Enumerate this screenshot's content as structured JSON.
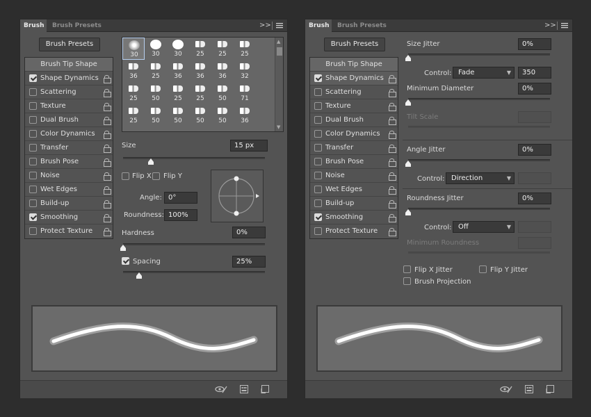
{
  "colors": {
    "bg": "#2d2d2d",
    "panel": "#535353",
    "field": "#3a3a3a",
    "preview": "#6b6b6b"
  },
  "panel1": {
    "tabs": [
      "Brush",
      "Brush Presets"
    ],
    "menu_glyph": ">>",
    "brush_presets_label": "Brush Presets",
    "list": [
      {
        "label": "Brush Tip Shape",
        "header": true
      },
      {
        "label": "Shape Dynamics",
        "checked": true
      },
      {
        "label": "Scattering",
        "checked": false
      },
      {
        "label": "Texture",
        "checked": false
      },
      {
        "label": "Dual Brush",
        "checked": false
      },
      {
        "label": "Color Dynamics",
        "checked": false
      },
      {
        "label": "Transfer",
        "checked": false
      },
      {
        "label": "Brush Pose",
        "checked": false
      },
      {
        "label": "Noise",
        "checked": false
      },
      {
        "label": "Wet Edges",
        "checked": false
      },
      {
        "label": "Build-up",
        "checked": false
      },
      {
        "label": "Smoothing",
        "checked": true
      },
      {
        "label": "Protect Texture",
        "checked": false
      }
    ],
    "tips": [
      "30",
      "30",
      "30",
      "25",
      "25",
      "25",
      "36",
      "25",
      "36",
      "36",
      "36",
      "32",
      "25",
      "50",
      "25",
      "25",
      "50",
      "71",
      "25",
      "50",
      "50",
      "50",
      "50",
      "36"
    ],
    "size_label": "Size",
    "size_value": "15 px",
    "flip_x_label": "Flip X",
    "flip_y_label": "Flip Y",
    "angle_label": "Angle:",
    "angle_value": "0°",
    "roundness_label": "Roundness:",
    "roundness_value": "100%",
    "hardness_label": "Hardness",
    "hardness_value": "0%",
    "spacing_label": "Spacing",
    "spacing_value": "25%"
  },
  "panel2": {
    "tabs": [
      "Brush",
      "Brush Presets"
    ],
    "menu_glyph": ">>",
    "brush_presets_label": "Brush Presets",
    "list": [
      {
        "label": "Brush Tip Shape",
        "header": true
      },
      {
        "label": "Shape Dynamics",
        "checked": true
      },
      {
        "label": "Scattering",
        "checked": false
      },
      {
        "label": "Texture",
        "checked": false
      },
      {
        "label": "Dual Brush",
        "checked": false
      },
      {
        "label": "Color Dynamics",
        "checked": false
      },
      {
        "label": "Transfer",
        "checked": false
      },
      {
        "label": "Brush Pose",
        "checked": false
      },
      {
        "label": "Noise",
        "checked": false
      },
      {
        "label": "Wet Edges",
        "checked": false
      },
      {
        "label": "Build-up",
        "checked": false
      },
      {
        "label": "Smoothing",
        "checked": true
      },
      {
        "label": "Protect Texture",
        "checked": false
      }
    ],
    "size_jitter_label": "Size Jitter",
    "size_jitter_value": "0%",
    "control_label": "Control:",
    "control_fade": "Fade",
    "fade_steps": "350",
    "min_diameter_label": "Minimum Diameter",
    "min_diameter_value": "0%",
    "tilt_scale_label": "Tilt Scale",
    "angle_jitter_label": "Angle Jitter",
    "angle_jitter_value": "0%",
    "control_direction": "Direction",
    "roundness_jitter_label": "Roundness Jitter",
    "roundness_jitter_value": "0%",
    "control_off": "Off",
    "min_roundness_label": "Minimum Roundness",
    "flip_x_jitter_label": "Flip X Jitter",
    "flip_y_jitter_label": "Flip Y Jitter",
    "brush_projection_label": "Brush Projection"
  }
}
